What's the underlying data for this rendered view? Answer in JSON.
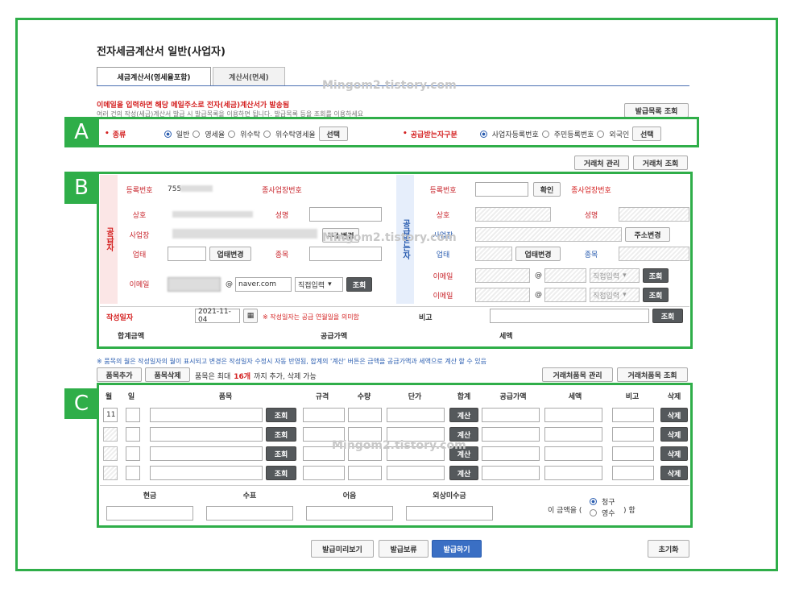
{
  "page_title": "전자세금계산서 일반(사업자)",
  "tabs": [
    "세금계산서(영세율포함)",
    "계산서(면세)"
  ],
  "watermark": "Mingom2.tistory.com",
  "notice_line1": "이메일을 입력하면 해당 메일주소로 전자(세금)계산서가 발송됨",
  "notice_line2": "여러 건의 작성(세금)계산서 발급 시 발급목록을 이용하면 됩니다. 발급목록 등을 조회를 이용하세요",
  "btn_issue_list": "발급목록 조회",
  "labels": {
    "A": "A",
    "B": "B",
    "C": "C"
  },
  "sectionA": {
    "type_label": "종류",
    "types": [
      "일반",
      "영세율",
      "위수탁",
      "위수탁영세율"
    ],
    "type_selected": "일반",
    "select_btn": "선택",
    "recipient_label": "공급받는자구분",
    "recipient_types": [
      "사업자등록번호",
      "주민등록번호",
      "외국인"
    ],
    "recipient_selected": "사업자등록번호",
    "select_btn2": "선택"
  },
  "toolbar_mid": {
    "partner_manage": "거래처 관리",
    "partner_search": "거래처 조회"
  },
  "supplier": {
    "side_label": "공급자",
    "reg_no_label": "등록번호",
    "reg_no_value": "755",
    "sub_no_label": "종사업장번호",
    "name_label": "상호",
    "rep_label": "성명",
    "addr_label": "사업장",
    "addr_btn": "주소변경",
    "biz_label": "업태",
    "biz_btn": "업태변경",
    "item_label": "종목",
    "email_label": "이메일",
    "email_at": "@",
    "email_domain": "naver.com",
    "email_select": "직접입력",
    "email_btn": "조회"
  },
  "recipient": {
    "side_label": "공급받는자",
    "reg_no_label": "등록번호",
    "confirm_btn": "확인",
    "sub_no_label": "종사업장번호",
    "name_label": "상호",
    "rep_label": "성명",
    "addr_label": "사업장",
    "addr_btn": "주소변경",
    "biz_label": "업태",
    "biz_btn": "업태변경",
    "item_label": "종목",
    "email_label": "이메일",
    "email_at": "@",
    "email_select": "직접입력",
    "email_btn": "조회"
  },
  "date_row": {
    "label": "작성일자",
    "value": "2021-11-04",
    "hint": "※ 작성일자는 공급 연월일을 의미함",
    "memo_label": "비고",
    "memo_btn": "조회"
  },
  "totals": {
    "sum_label": "합계금액",
    "supply_label": "공급가액",
    "tax_label": "세액"
  },
  "item_notice": "※ 품목의 월은 작성일자의 월이 표시되고 변경은 작성일자 수정시 자동 반영됨, 합계의 '계산' 버튼은 금액을 공급가액과 세액으로 계산 할 수 있음",
  "item_toolbar": {
    "add": "품목추가",
    "delete": "품목삭제",
    "limit_pre": "품목은 최대",
    "limit_num": "16개",
    "limit_post": "까지 추가, 삭제 가능",
    "partner_item_manage": "거래처품목 관리",
    "partner_item_search": "거래처품목 조회"
  },
  "item_headers": [
    "월",
    "일",
    "품목",
    "규격",
    "수량",
    "단가",
    "합계",
    "공급가액",
    "세액",
    "비고",
    "삭제"
  ],
  "item_rows": [
    {
      "month": "11",
      "search": "조회",
      "calc": "계산",
      "del": "삭제"
    },
    {
      "month": "",
      "search": "조회",
      "calc": "계산",
      "del": "삭제"
    },
    {
      "month": "",
      "search": "조회",
      "calc": "계산",
      "del": "삭제"
    },
    {
      "month": "",
      "search": "조회",
      "calc": "계산",
      "del": "삭제"
    }
  ],
  "payment_headers": [
    "현금",
    "수표",
    "어음",
    "외상미수금"
  ],
  "amount_prefix": "이 금액을 (",
  "amount_options": [
    "청구",
    "영수"
  ],
  "amount_selected": "청구",
  "amount_suffix": ") 함",
  "footer": {
    "preview": "발급미리보기",
    "hold": "발급보류",
    "issue": "발급하기",
    "reset": "초기화"
  },
  "colors": {
    "frame": "#2fae49",
    "accent": "#2a5db0",
    "required": "#d42020"
  }
}
